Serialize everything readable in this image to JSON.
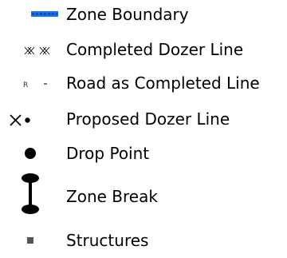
{
  "legend": {
    "items": [
      {
        "label": "Zone Boundary",
        "icon": "zone-boundary-icon"
      },
      {
        "label": "Completed Dozer Line",
        "icon": "completed-dozer-line-icon"
      },
      {
        "label": "Road as Completed Line",
        "icon": "road-completed-line-icon",
        "symbol_text": "R"
      },
      {
        "label": "Proposed Dozer Line",
        "icon": "proposed-dozer-line-icon"
      },
      {
        "label": "Drop Point",
        "icon": "drop-point-icon"
      },
      {
        "label": "Zone Break",
        "icon": "zone-break-icon"
      },
      {
        "label": "Structures",
        "icon": "structures-icon"
      }
    ]
  },
  "colors": {
    "zone_boundary_fill": "#1f6fe0",
    "zone_boundary_dash": "#0a2a8c",
    "symbol": "#000000",
    "road_symbol": "#333333",
    "structure": "#555555",
    "text": "#000000"
  }
}
